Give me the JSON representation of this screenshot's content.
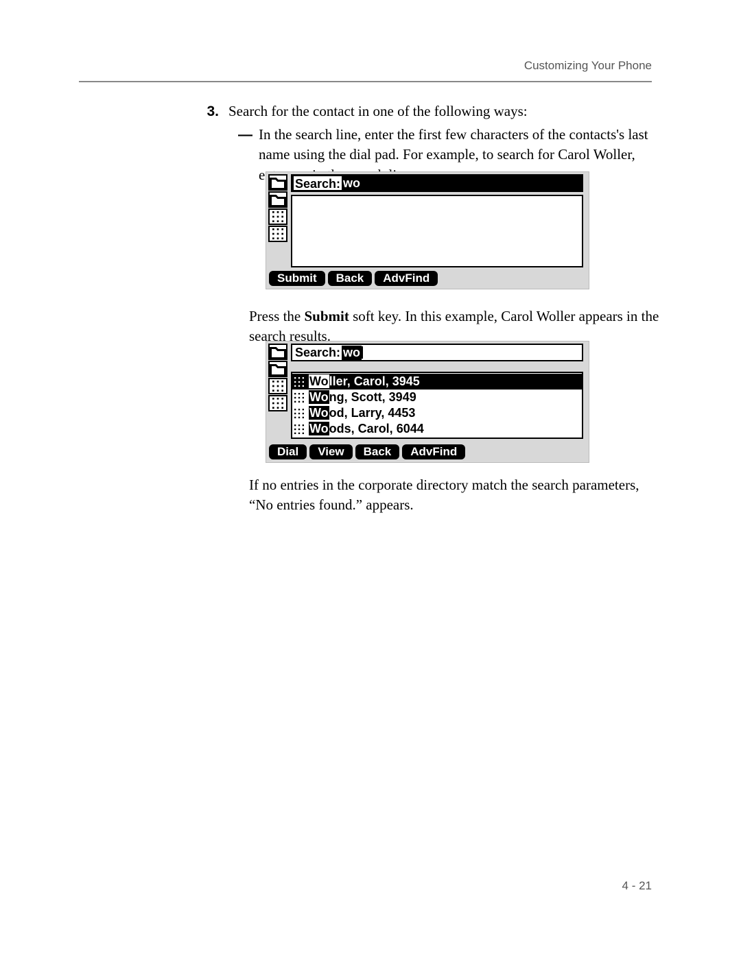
{
  "header": {
    "title": "Customizing Your Phone"
  },
  "step": {
    "number": "3.",
    "text": "Search for the contact in one of the following ways:"
  },
  "bullet": {
    "dash": "—",
    "line1": "In the search line, enter the first few characters of the contacts's last name using the dial pad. For example, to search for Carol Woller, enter ",
    "bold_wo": "wo",
    "line1_tail": " in the search line."
  },
  "lcd1": {
    "search_label": "Search:",
    "search_value": "wo",
    "softkeys": [
      "Submit",
      "Back",
      "AdvFind"
    ]
  },
  "para2": {
    "pre": "Press the ",
    "bold": "Submit",
    "post": " soft key. In this example, Carol Woller appears in the search results."
  },
  "lcd2": {
    "search_label": "Search:",
    "search_value": "wo",
    "results": [
      {
        "prefix": "Wo",
        "rest": "ller, Carol, 3945",
        "selected": true
      },
      {
        "prefix": "Wo",
        "rest": "ng, Scott, 3949",
        "selected": false
      },
      {
        "prefix": "Wo",
        "rest": "od, Larry, 4453",
        "selected": false
      },
      {
        "prefix": "Wo",
        "rest": "ods, Carol, 6044",
        "selected": false
      }
    ],
    "softkeys": [
      "Dial",
      "View",
      "Back",
      "AdvFind"
    ]
  },
  "para3": "If no entries in the corporate directory match the search parameters, “No entries found.” appears.",
  "footer": {
    "page": "4 - 21"
  }
}
